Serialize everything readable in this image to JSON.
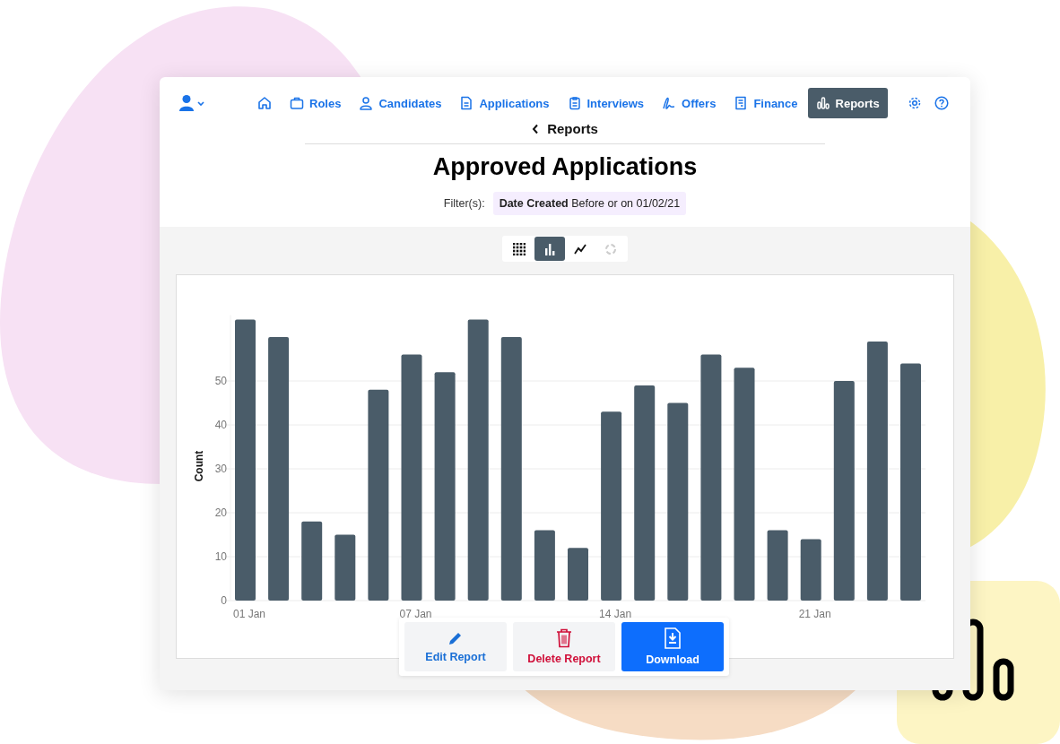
{
  "nav": {
    "items": [
      {
        "label": "Roles",
        "selected": false
      },
      {
        "label": "Candidates",
        "selected": false
      },
      {
        "label": "Applications",
        "selected": false
      },
      {
        "label": "Interviews",
        "selected": false
      },
      {
        "label": "Offers",
        "selected": false
      },
      {
        "label": "Finance",
        "selected": false
      },
      {
        "label": "Reports",
        "selected": true
      }
    ]
  },
  "breadcrumb": {
    "back_label": "Reports"
  },
  "title": "Approved Applications",
  "filters": {
    "label": "Filter(s):",
    "items": [
      {
        "field": "Date Created",
        "condition": "Before or on 01/02/21"
      }
    ]
  },
  "views": [
    {
      "selected": false,
      "disabled": false
    },
    {
      "selected": true,
      "disabled": false
    },
    {
      "selected": false,
      "disabled": false
    },
    {
      "selected": false,
      "disabled": true
    }
  ],
  "chart_data": {
    "type": "bar",
    "ylabel": "Count",
    "categories": [
      "01 Jan",
      null,
      null,
      null,
      null,
      "07 Jan",
      null,
      null,
      null,
      null,
      null,
      "14 Jan",
      null,
      null,
      null,
      null,
      null,
      "21 Jan",
      null,
      null,
      null
    ],
    "series": [
      {
        "color": "#4a5c69",
        "values": [
          64,
          60,
          18,
          15,
          48,
          56,
          52,
          64,
          60,
          16,
          12,
          43,
          49,
          45,
          56,
          53,
          16,
          14,
          50,
          59,
          54
        ]
      }
    ],
    "ylim": [
      0,
      65
    ],
    "yticks": [
      0,
      10,
      20,
      30,
      40,
      50
    ],
    "grid": true
  },
  "actions": [
    {
      "label": "Edit Report",
      "kind": "secondary"
    },
    {
      "label": "Delete Report",
      "kind": "danger"
    },
    {
      "label": "Download",
      "kind": "primary"
    }
  ]
}
